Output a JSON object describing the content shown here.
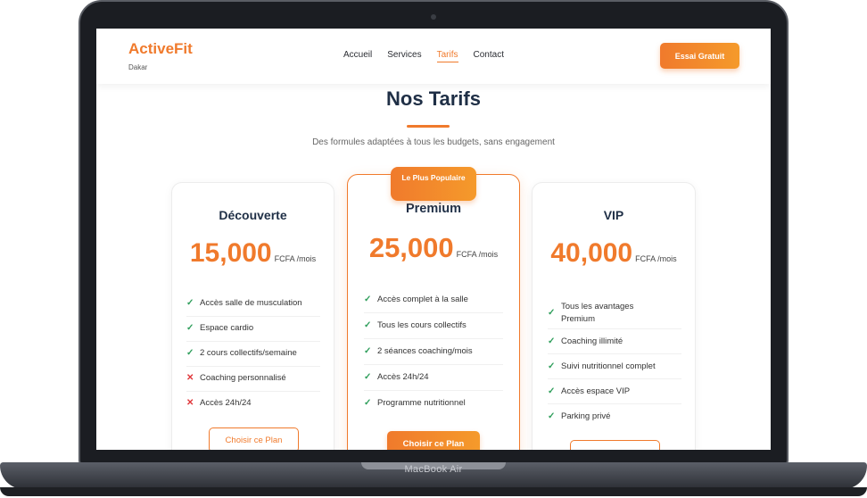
{
  "device": {
    "label": "MacBook Air"
  },
  "header": {
    "brand": "ActiveFit",
    "brand_sub": "Dakar",
    "nav": [
      "Accueil",
      "Services",
      "Tarifs",
      "Contact"
    ],
    "active_nav": "Tarifs",
    "cta": "Essai Gratuit"
  },
  "section": {
    "title": "Nos Tarifs",
    "subtitle": "Des formules adaptées à tous les budgets, sans engagement"
  },
  "plans": [
    {
      "name": "Découverte",
      "price": "15,000",
      "unit": "FCFA /mois",
      "features": [
        {
          "text": "Accès salle de musculation",
          "included": true
        },
        {
          "text": "Espace cardio",
          "included": true
        },
        {
          "text": "2 cours collectifs/semaine",
          "included": true
        },
        {
          "text": "Coaching personnalisé",
          "included": false
        },
        {
          "text": "Accès 24h/24",
          "included": false
        }
      ],
      "button": "Choisir ce Plan"
    },
    {
      "name": "Premium",
      "badge": "Le Plus Populaire",
      "price": "25,000",
      "unit": "FCFA /mois",
      "features": [
        {
          "text": "Accès complet à la salle",
          "included": true
        },
        {
          "text": "Tous les cours collectifs",
          "included": true
        },
        {
          "text": "2 séances coaching/mois",
          "included": true
        },
        {
          "text": "Accès 24h/24",
          "included": true
        },
        {
          "text": "Programme nutritionnel",
          "included": true
        }
      ],
      "button": "Choisir ce Plan"
    },
    {
      "name": "VIP",
      "price": "40,000",
      "unit": "FCFA /mois",
      "features": [
        {
          "text": "Tous les avantages Premium",
          "included": true
        },
        {
          "text": "Coaching illimité",
          "included": true
        },
        {
          "text": "Suivi nutritionnel complet",
          "included": true
        },
        {
          "text": "Accès espace VIP",
          "included": true
        },
        {
          "text": "Parking privé",
          "included": true
        }
      ],
      "button": ""
    }
  ],
  "icons": {
    "included": "check-icon",
    "excluded": "cross-icon"
  },
  "colors": {
    "accent": "#f07a2c",
    "heading": "#1f2f46",
    "check": "#2e9e5b",
    "cross": "#e0383b"
  }
}
